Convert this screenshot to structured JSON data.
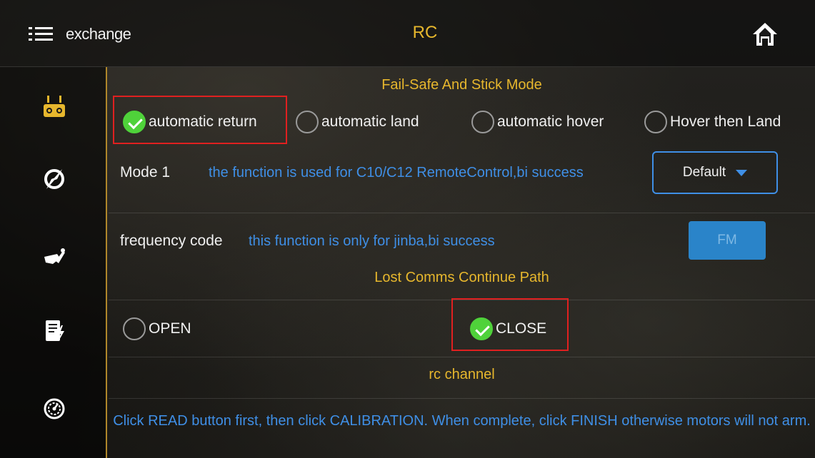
{
  "header": {
    "menu_label": "exchange",
    "title": "RC",
    "icons": {
      "menu": "list-menu-icon",
      "home": "home-icon"
    }
  },
  "sidebar": {
    "items": [
      {
        "icon": "remote-controller-icon",
        "active": true,
        "color": "#e7b72d"
      },
      {
        "icon": "compass-icon",
        "active": false
      },
      {
        "icon": "drone-wrench-icon",
        "active": false
      },
      {
        "icon": "battery-charge-icon",
        "active": false
      },
      {
        "icon": "gauge-icon",
        "active": false
      }
    ]
  },
  "failsafe": {
    "title": "Fail-Safe And Stick Mode",
    "options": [
      {
        "label": "automatic return",
        "checked": true
      },
      {
        "label": "automatic land",
        "checked": false
      },
      {
        "label": "automatic hover",
        "checked": false
      },
      {
        "label": "Hover then Land",
        "checked": false
      }
    ]
  },
  "stick_mode": {
    "label": "Mode 1",
    "description": "the function is used for C10/C12 RemoteControl,bi success",
    "dropdown_value": "Default"
  },
  "frequency": {
    "label": "frequency code",
    "description": "this function is only for jinba,bi success",
    "button_label": "FM"
  },
  "lost_comms": {
    "title": "Lost Comms Continue Path",
    "options": [
      {
        "label": "OPEN",
        "checked": false
      },
      {
        "label": "CLOSE",
        "checked": true
      }
    ]
  },
  "rc_channel": {
    "title": "rc channel",
    "note": "Click READ button first, then click CALIBRATION. When complete, click FINISH otherwise motors will not arm."
  },
  "colors": {
    "accent": "#e7b72d",
    "link": "#3f8fe6",
    "checked": "#4fd23a",
    "highlight": "#e02020",
    "fm_button": "#2a84c9"
  }
}
